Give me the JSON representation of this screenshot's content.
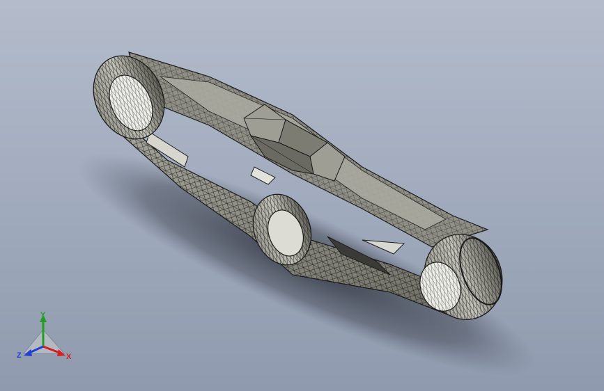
{
  "viewport": {
    "background_top": "#b4bccb",
    "background_bottom": "#8f9aae"
  },
  "model": {
    "icon": "mechanical-linkage-mesh",
    "face_color": "#8e8e84",
    "edge_color": "#1a1a1a"
  },
  "triad": {
    "x_label": "X",
    "y_label": "Y",
    "z_label": "Z",
    "x_color": "#d42020",
    "y_color": "#20a020",
    "z_color": "#2040d0"
  }
}
